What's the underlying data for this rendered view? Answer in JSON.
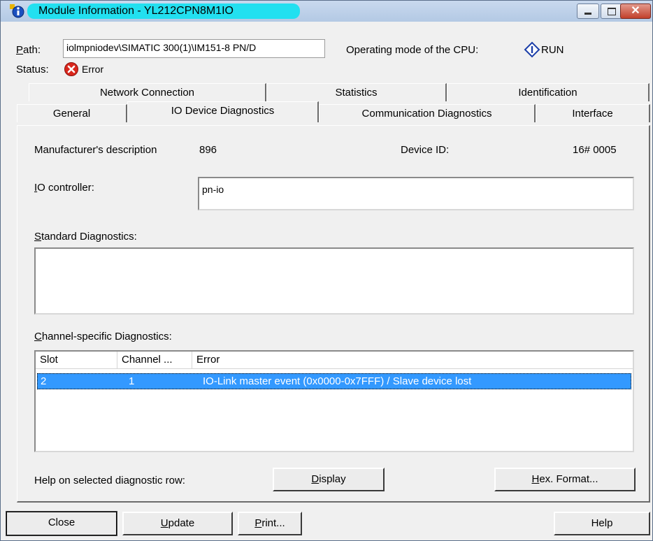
{
  "window": {
    "title": "Module Information - YL212CPN8M1IO",
    "icon": "info-icon"
  },
  "path": {
    "label_prefix": "P",
    "label_rest": "ath:",
    "value": "iolmpniodev\\SIMATIC 300(1)\\IM151-8 PN/D"
  },
  "operating_mode": {
    "label": "Operating mode of the  CPU:",
    "value": "RUN"
  },
  "status": {
    "label": "Status:",
    "value": "Error",
    "icon": "error-icon",
    "color": "#d9261c"
  },
  "tabs_row1": [
    {
      "label": "Network Connection"
    },
    {
      "label": "Statistics"
    },
    {
      "label": "Identification"
    }
  ],
  "tabs_row2": [
    {
      "label": "General"
    },
    {
      "label": "IO Device Diagnostics"
    },
    {
      "label": "Communication Diagnostics"
    },
    {
      "label": "Interface"
    }
  ],
  "device": {
    "manufacturer_label": "Manufacturer's description",
    "manufacturer_value": "896",
    "device_id_label": "Device ID:",
    "device_id_value": "16# 0005",
    "io_controller_label_first": "I",
    "io_controller_label_rest": "O controller:",
    "io_controller_value": "pn-io"
  },
  "standard_diagnostics": {
    "label_first": "S",
    "label_rest": "tandard Diagnostics:",
    "value": ""
  },
  "channel_diagnostics": {
    "label_first": "C",
    "label_rest": "hannel-specific Diagnostics:",
    "columns": [
      "Slot",
      "Channel ...",
      "Error"
    ],
    "rows": [
      {
        "slot": "2",
        "channel": "1",
        "error": "IO-Link master event (0x0000-0x7FFF) / Slave device lost"
      }
    ],
    "selection_color": "#3399ff"
  },
  "help_row": {
    "label": "Help on selected diagnostic row:",
    "display_first": "D",
    "display_rest": "isplay",
    "hex_first": "H",
    "hex_rest": "ex. Format..."
  },
  "footer": {
    "close": "Close",
    "update_first": "U",
    "update_rest": "pdate",
    "print_first": "P",
    "print_rest": "rint...",
    "help": "Help"
  }
}
